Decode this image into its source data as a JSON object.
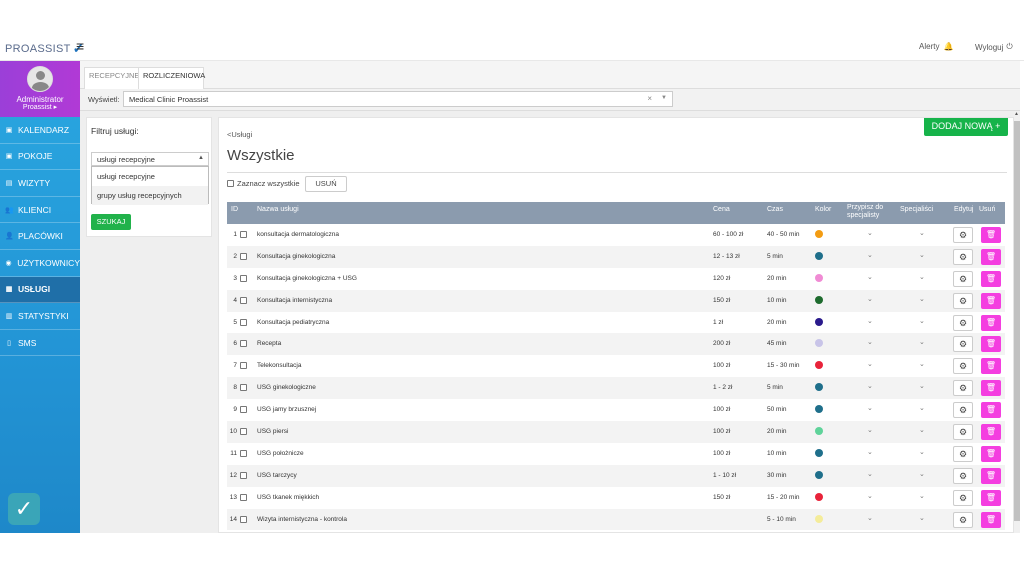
{
  "app": {
    "logo_text": "PROASSIST",
    "alerts_label": "Alerty",
    "logout_label": "Wyloguj"
  },
  "profile": {
    "name": "Administrator",
    "subtitle": "Proassist ▸"
  },
  "sidebar": {
    "items": [
      {
        "label": "KALENDARZ",
        "icon": "calendar-icon"
      },
      {
        "label": "POKOJE",
        "icon": "rooms-icon"
      },
      {
        "label": "WIZYTY",
        "icon": "visits-icon"
      },
      {
        "label": "KLIENCI",
        "icon": "clients-icon"
      },
      {
        "label": "PLACÓWKI",
        "icon": "facilities-icon"
      },
      {
        "label": "UŻYTKOWNICY",
        "icon": "users-icon"
      },
      {
        "label": "USŁUGI",
        "icon": "services-icon",
        "active": true
      },
      {
        "label": "STATYSTYKI",
        "icon": "stats-icon"
      },
      {
        "label": "SMS",
        "icon": "sms-icon"
      }
    ]
  },
  "tabs": [
    {
      "label": "RECEPCYJNE"
    },
    {
      "label": "ROZLICZENIOWA"
    }
  ],
  "display": {
    "label": "Wyświetl:",
    "value": "Medical Clinic Proassist"
  },
  "filter": {
    "title": "Filtruj usługi:",
    "selected": "usługi recepcyjne",
    "options": [
      "usługi recepcyjne",
      "grupy usług recepcyjnych"
    ],
    "search_label": "SZUKAJ"
  },
  "main": {
    "breadcrumb": "<Usługi",
    "title": "Wszystkie",
    "add_label": "DODAJ NOWĄ +",
    "select_all_label": "Zaznacz wszystkie",
    "delete_label": "USUŃ"
  },
  "table": {
    "headers": {
      "id": "ID",
      "name": "Nazwa usługi",
      "price": "Cena",
      "time": "Czas",
      "color": "Kolor",
      "assign": "Przypisz do specjalisty",
      "specialists": "Specjaliści",
      "edit": "Edytuj",
      "remove": "Usuń"
    },
    "rows": [
      {
        "id": "1",
        "name": "konsultacja dermatologiczna",
        "price": "60 - 100 zł",
        "time": "40 - 50 min",
        "color": "#f39c12"
      },
      {
        "id": "2",
        "name": "Konsultacja ginekologiczna",
        "price": "12 - 13 zł",
        "time": "5 min",
        "color": "#1f6f8b"
      },
      {
        "id": "3",
        "name": "Konsultacja ginekologiczna + USG",
        "price": "120 zł",
        "time": "20 min",
        "color": "#f08bd4"
      },
      {
        "id": "4",
        "name": "Konsultacja internistyczna",
        "price": "150 zł",
        "time": "10 min",
        "color": "#1e6b2e"
      },
      {
        "id": "5",
        "name": "Konsultacja pediatryczna",
        "price": "1 zł",
        "time": "20 min",
        "color": "#2a1a8c"
      },
      {
        "id": "6",
        "name": "Recepta",
        "price": "200 zł",
        "time": "45 min",
        "color": "#c8c4e8"
      },
      {
        "id": "7",
        "name": "Telekonsultacja",
        "price": "100 zł",
        "time": "15 - 30 min",
        "color": "#e8233a"
      },
      {
        "id": "8",
        "name": "USG ginekologiczne",
        "price": "1 - 2 zł",
        "time": "5 min",
        "color": "#1f6f8b"
      },
      {
        "id": "9",
        "name": "USG jamy brzusznej",
        "price": "100 zł",
        "time": "50 min",
        "color": "#1f6f8b"
      },
      {
        "id": "10",
        "name": "USG piersi",
        "price": "100 zł",
        "time": "20 min",
        "color": "#5fd39a"
      },
      {
        "id": "11",
        "name": "USG położnicze",
        "price": "100 zł",
        "time": "10 min",
        "color": "#1f6f8b"
      },
      {
        "id": "12",
        "name": "USG tarczycy",
        "price": "1 - 10 zł",
        "time": "30 min",
        "color": "#1f6f8b"
      },
      {
        "id": "13",
        "name": "USG tkanek miękkich",
        "price": "150 zł",
        "time": "15 - 20 min",
        "color": "#e8233a"
      },
      {
        "id": "14",
        "name": "Wizyta internistyczna - kontrola",
        "price": "",
        "time": "5 - 10 min",
        "color": "#f4ec9a"
      }
    ]
  }
}
